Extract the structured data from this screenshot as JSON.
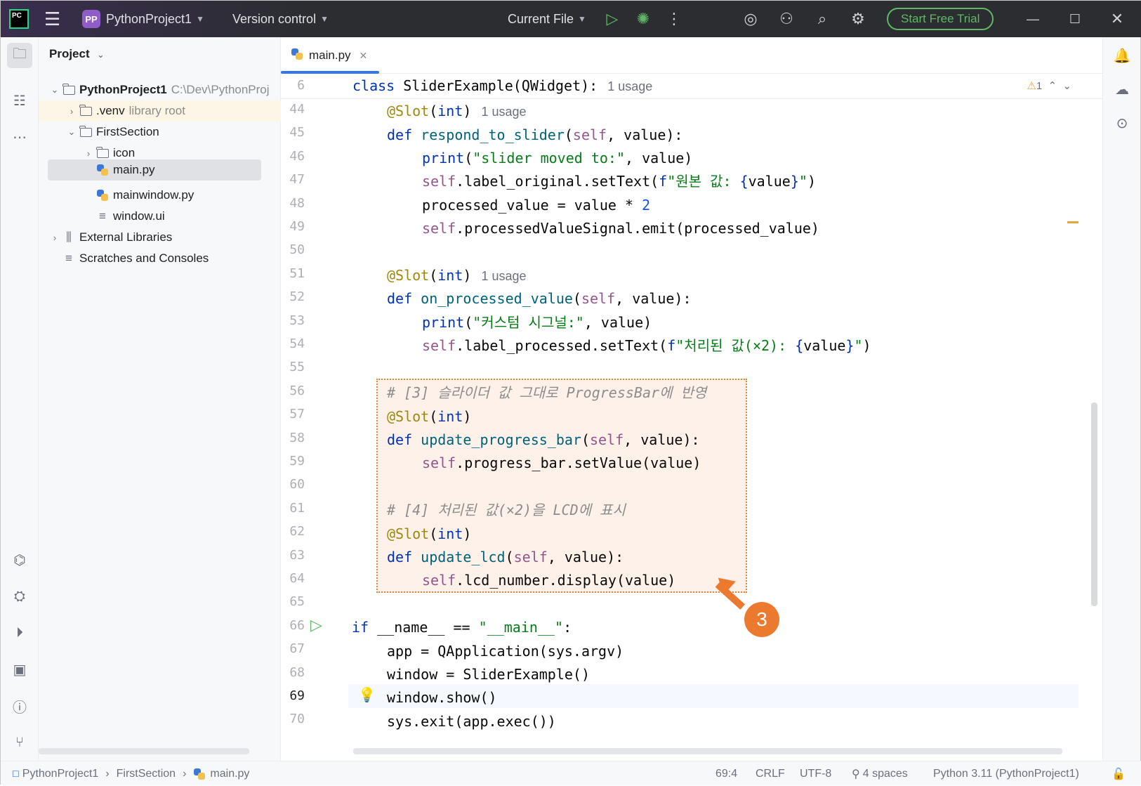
{
  "titlebar": {
    "logo": "PC",
    "project_badge": "PP",
    "project_name": "PythonProject1",
    "vcs": "Version control",
    "run_config": "Current File",
    "start_trial": "Start Free Trial"
  },
  "project_panel": {
    "title": "Project",
    "tree": [
      {
        "name": "PythonProject1",
        "hint": "C:\\Dev\\PythonProj",
        "icon": "folder-icon"
      },
      {
        "name": ".venv",
        "hint": "library root",
        "icon": "folder-icon"
      },
      {
        "name": "FirstSection",
        "hint": "",
        "icon": "folder-icon"
      },
      {
        "name": "icon",
        "hint": "",
        "icon": "folder-icon"
      },
      {
        "name": "main.py",
        "hint": "",
        "icon": "python-file-icon"
      },
      {
        "name": "mainwindow.py",
        "hint": "",
        "icon": "python-file-icon"
      },
      {
        "name": "window.ui",
        "hint": "",
        "icon": "ui-file-icon"
      },
      {
        "name": "External Libraries",
        "hint": "",
        "icon": "library-icon"
      },
      {
        "name": "Scratches and Consoles",
        "hint": "",
        "icon": "scratches-icon"
      }
    ]
  },
  "editor": {
    "tab_name": "main.py",
    "sticky_line": "6",
    "sticky_kw": "class",
    "sticky_code": " SliderExample(QWidget):",
    "sticky_usage": "1 usage",
    "warning_count": "1",
    "line_numbers": [
      "44",
      "45",
      "46",
      "47",
      "48",
      "49",
      "50",
      "51",
      "52",
      "53",
      "54",
      "55",
      "56",
      "57",
      "58",
      "59",
      "60",
      "61",
      "62",
      "63",
      "64",
      "65",
      "66",
      "67",
      "68",
      "69",
      "70"
    ],
    "usage_label": "1 usage",
    "marker_number": "3"
  },
  "statusbar": {
    "breadcrumb": [
      "PythonProject1",
      "FirstSection",
      "main.py"
    ],
    "position": "69:4",
    "line_sep": "CRLF",
    "encoding": "UTF-8",
    "indent": "4 spaces",
    "interpreter": "Python 3.11 (PythonProject1)"
  },
  "colors": {
    "accent": "#3574f0",
    "highlight_border": "#e8833a",
    "highlight_fill": "#fdf1e9",
    "marker": "#ec7a2e",
    "trial": "#5fb865"
  }
}
